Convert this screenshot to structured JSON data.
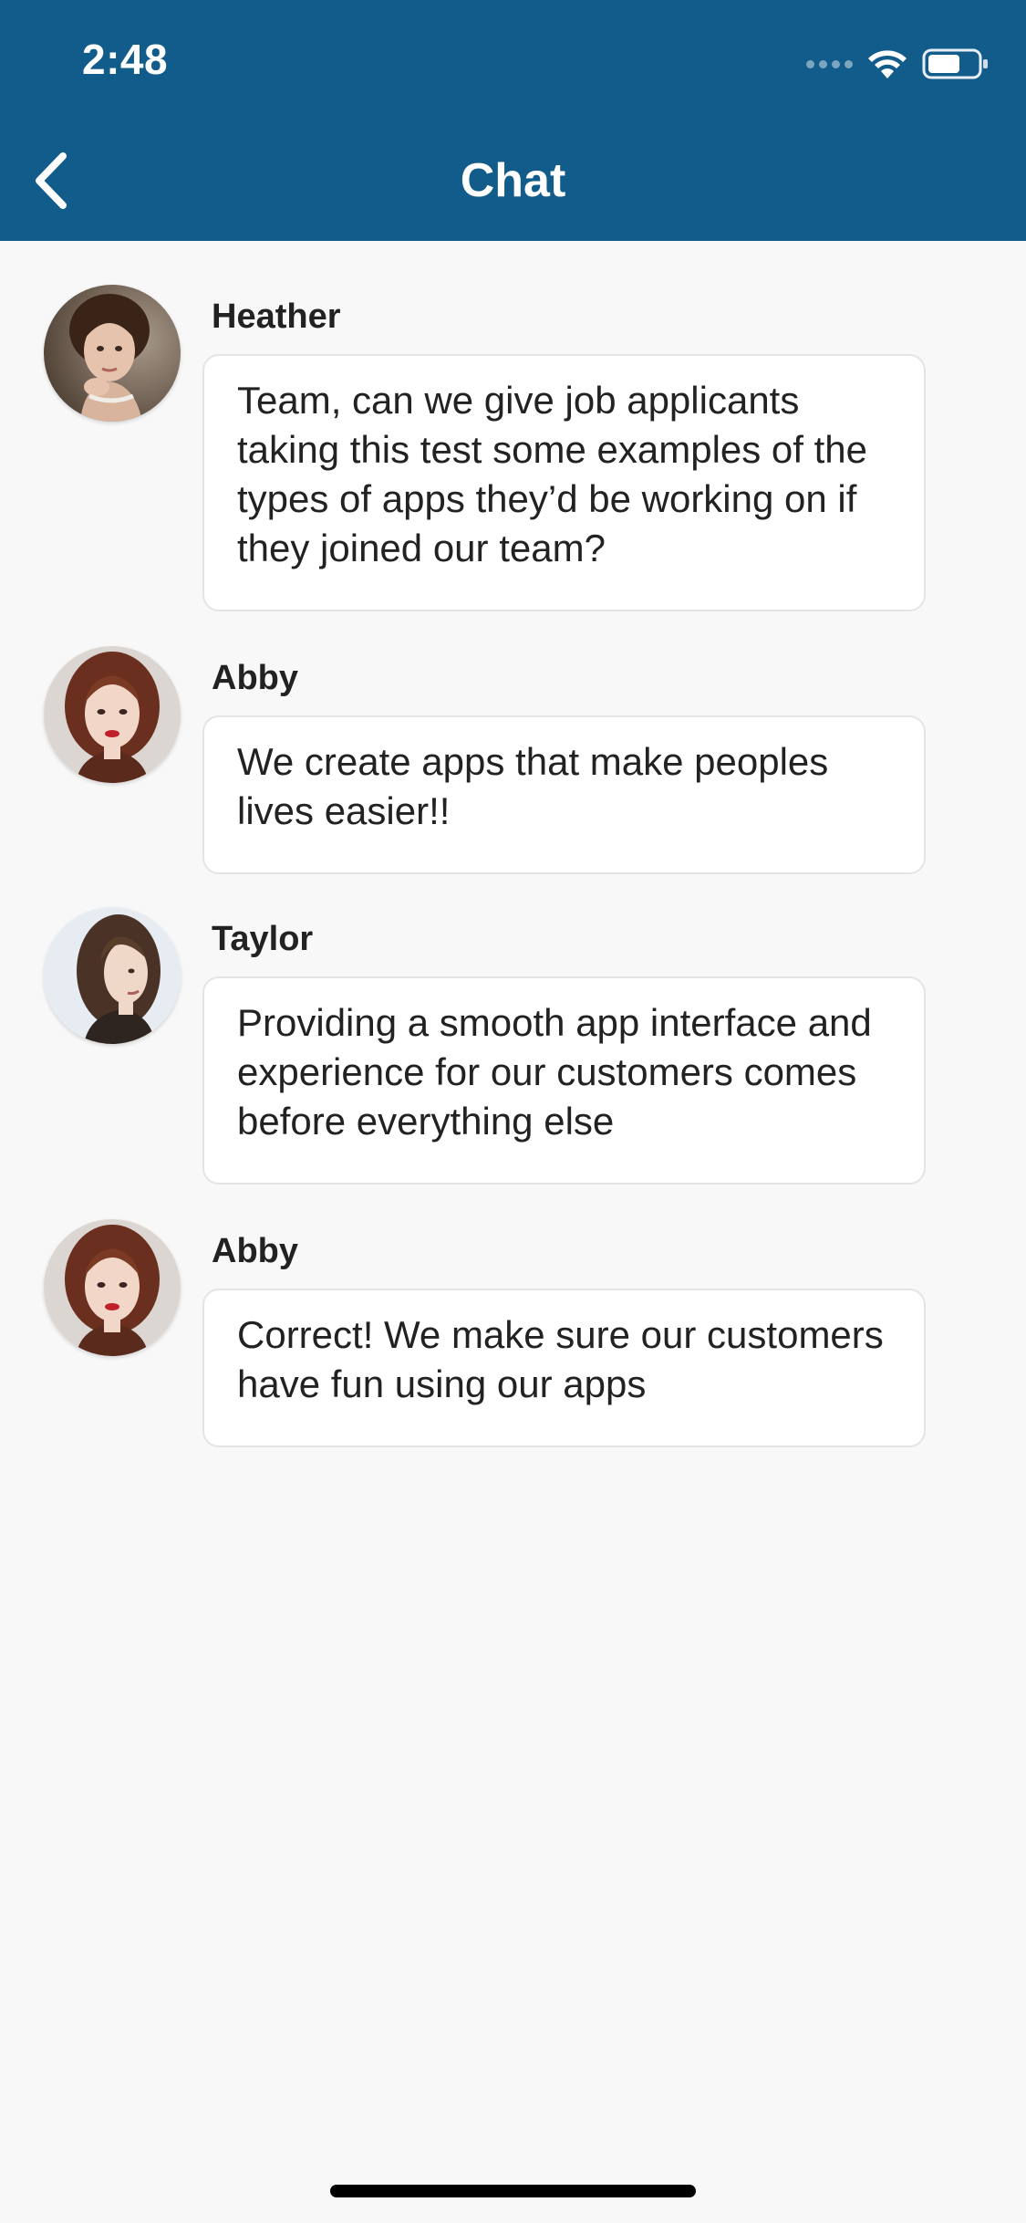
{
  "status_bar": {
    "time": "2:48",
    "wifi_icon": "wifi-icon",
    "battery_icon": "battery-icon"
  },
  "nav": {
    "title": "Chat",
    "back_icon": "chevron-left-icon"
  },
  "colors": {
    "header": "#125c8c",
    "background": "#f8f8f8",
    "bubble": "#ffffff",
    "text": "#222222"
  },
  "messages": [
    {
      "sender": "Heather",
      "text": "Team, can we give job applicants taking this test some examples of the types of apps they’d be working on if they joined our team?"
    },
    {
      "sender": "Abby",
      "text": "We create apps that make peoples lives easier!!"
    },
    {
      "sender": "Taylor",
      "text": "Providing a smooth app interface and experience for our customers comes before everything else"
    },
    {
      "sender": "Abby",
      "text": "Correct! We make sure our customers have fun using our apps"
    }
  ]
}
